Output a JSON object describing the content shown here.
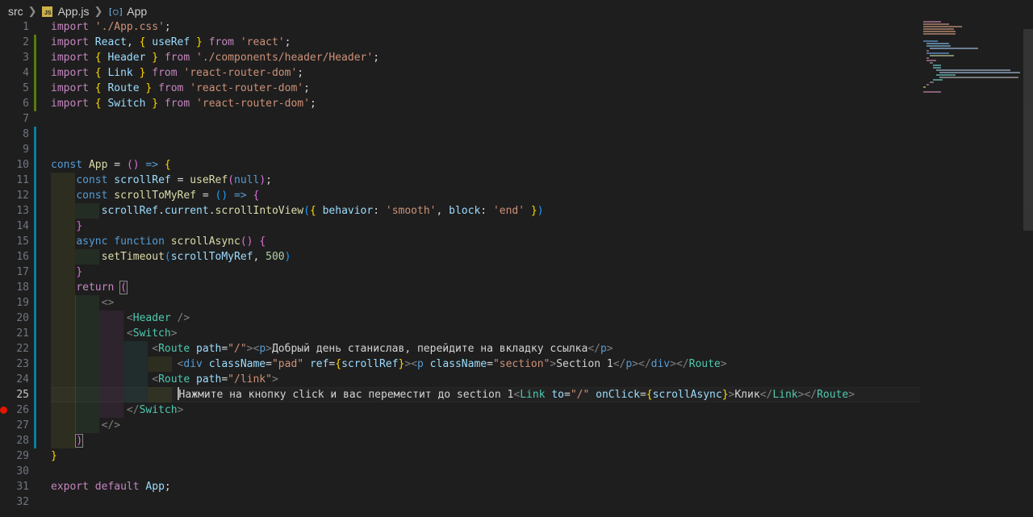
{
  "breadcrumb": {
    "folder": "src",
    "file": "App.js",
    "file_icon": "JS",
    "symbol": "App",
    "symbol_icon": "symbol-variable-icon"
  },
  "editor": {
    "active_line": 25,
    "breakpoint_line": 26,
    "colors": {
      "background": "#1e1e1e",
      "keyword": "#c586c0",
      "string": "#ce9178",
      "component": "#4ec9b0"
    },
    "lines": [
      {
        "n": "1"
      },
      {
        "n": "2"
      },
      {
        "n": "3"
      },
      {
        "n": "4"
      },
      {
        "n": "5"
      },
      {
        "n": "6"
      },
      {
        "n": "7"
      },
      {
        "n": "8"
      },
      {
        "n": "9"
      },
      {
        "n": "10"
      },
      {
        "n": "11"
      },
      {
        "n": "12"
      },
      {
        "n": "13"
      },
      {
        "n": "14"
      },
      {
        "n": "15"
      },
      {
        "n": "16"
      },
      {
        "n": "17"
      },
      {
        "n": "18"
      },
      {
        "n": "19"
      },
      {
        "n": "20"
      },
      {
        "n": "21"
      },
      {
        "n": "22"
      },
      {
        "n": "23"
      },
      {
        "n": "24"
      },
      {
        "n": "25"
      },
      {
        "n": "26"
      },
      {
        "n": "27"
      },
      {
        "n": "28"
      },
      {
        "n": "29"
      },
      {
        "n": "30"
      },
      {
        "n": "31"
      },
      {
        "n": "32"
      }
    ]
  },
  "code": {
    "kw_import": "import",
    "kw_from": "from",
    "kw_const": "const",
    "kw_async": "async",
    "kw_function": "function",
    "kw_return": "return",
    "kw_export": "export",
    "kw_default": "default",
    "l1_str": "'./App.css'",
    "l2_react": "React",
    "l2_useref": "useRef",
    "l2_str": "'react'",
    "l3_header": "Header",
    "l3_str": "'./components/header/Header'",
    "l4_link": "Link",
    "l4_str": "'react-router-dom'",
    "l5_route": "Route",
    "l5_str": "'react-router-dom'",
    "l6_switch": "Switch",
    "l6_str": "'react-router-dom'",
    "l10_app": "App",
    "l11_scrollref": "scrollRef",
    "l11_useref": "useRef",
    "l11_null": "null",
    "l12_fn": "scrollToMyRef",
    "l13_scrollref": "scrollRef",
    "l13_current": "current",
    "l13_method": "scrollIntoView",
    "l13_behavior": "behavior",
    "l13_smooth": "'smooth'",
    "l13_block": "block",
    "l13_end": "'end'",
    "l15_fn": "scrollAsync",
    "l16_settimeout": "setTimeout",
    "l16_arg": "scrollToMyRef",
    "l16_num": "500",
    "tag_header": "Header",
    "tag_switch": "Switch",
    "tag_route": "Route",
    "tag_p": "p",
    "tag_div": "div",
    "tag_link": "Link",
    "attr_path": "path",
    "attr_classname": "className",
    "attr_ref": "ref",
    "attr_to": "to",
    "attr_onclick": "onClick",
    "val_root": "\"/\"",
    "val_link": "\"/link\"",
    "val_pad": "\"pad\"",
    "val_section": "\"section\"",
    "l22_text": "Добрый день станислав, перейдите на вкладку ссылка",
    "l23_ref": "scrollRef",
    "l23_text": "Section 1",
    "l25_text": "Нажмите на кнопку click и вас переместит до section 1",
    "l25_handler": "scrollAsync",
    "l25_link_text": "Клик",
    "l31_app": "App"
  }
}
